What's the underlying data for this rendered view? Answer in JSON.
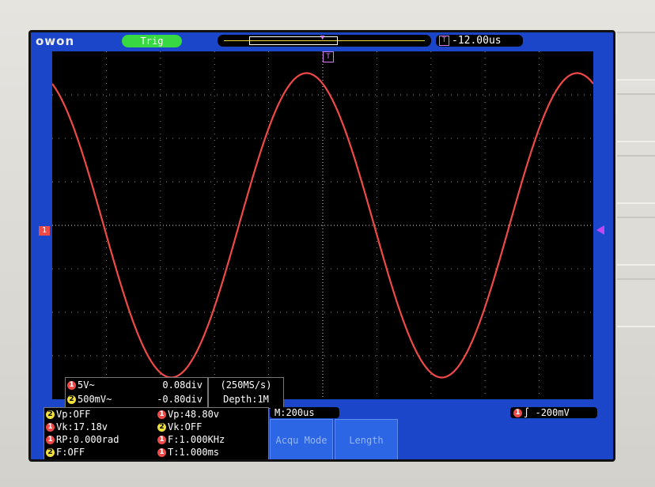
{
  "brand": {
    "logo_text": "owon"
  },
  "status": {
    "trigger_state": "Trig",
    "time_offset": "-12.00us",
    "trigger_badge_letter": "T"
  },
  "channels": [
    {
      "number": "1",
      "scale": "5V~",
      "position": "0.08div",
      "color": "#f04a48"
    },
    {
      "number": "2",
      "scale": "500mV~",
      "position": "-0.80div",
      "color": "#efe03a"
    }
  ],
  "sampling": {
    "rate": "(250MS/s)",
    "depth": "Depth:1M"
  },
  "measurements": {
    "left": [
      {
        "channel": "2",
        "text": "Vp:OFF"
      },
      {
        "channel": "1",
        "text": "Vk:17.18v"
      },
      {
        "channel": "1",
        "text": "RP:0.000rad"
      },
      {
        "channel": "2",
        "text": "F:OFF"
      }
    ],
    "right": [
      {
        "channel": "1",
        "text": "Vp:48.80v"
      },
      {
        "channel": "2",
        "text": "Vk:OFF"
      },
      {
        "channel": "1",
        "text": "F:1.000KHz"
      },
      {
        "channel": "1",
        "text": "T:1.000ms"
      }
    ]
  },
  "timebase": "M:200us",
  "trigger": {
    "channel": "1",
    "slope_symbol": "∫",
    "level": "-200mV"
  },
  "softkeys": [
    {
      "label": "Acqu Mode"
    },
    {
      "label": "Length"
    }
  ],
  "waveform": {
    "channel": "1",
    "color": "#f04a48",
    "grid_divisions": {
      "horizontal": 10,
      "vertical": 8
    },
    "period_divisions": 5,
    "amplitude_divisions": 3.5
  },
  "colors": {
    "screen_bg": "#1b46c9",
    "grid_bg": "#000000",
    "grid_dots": "#8a8a8a",
    "trig_ok": "#38d843",
    "ch1": "#f04a48",
    "ch2": "#efe03a",
    "trigger_marker": "#c346f2"
  }
}
